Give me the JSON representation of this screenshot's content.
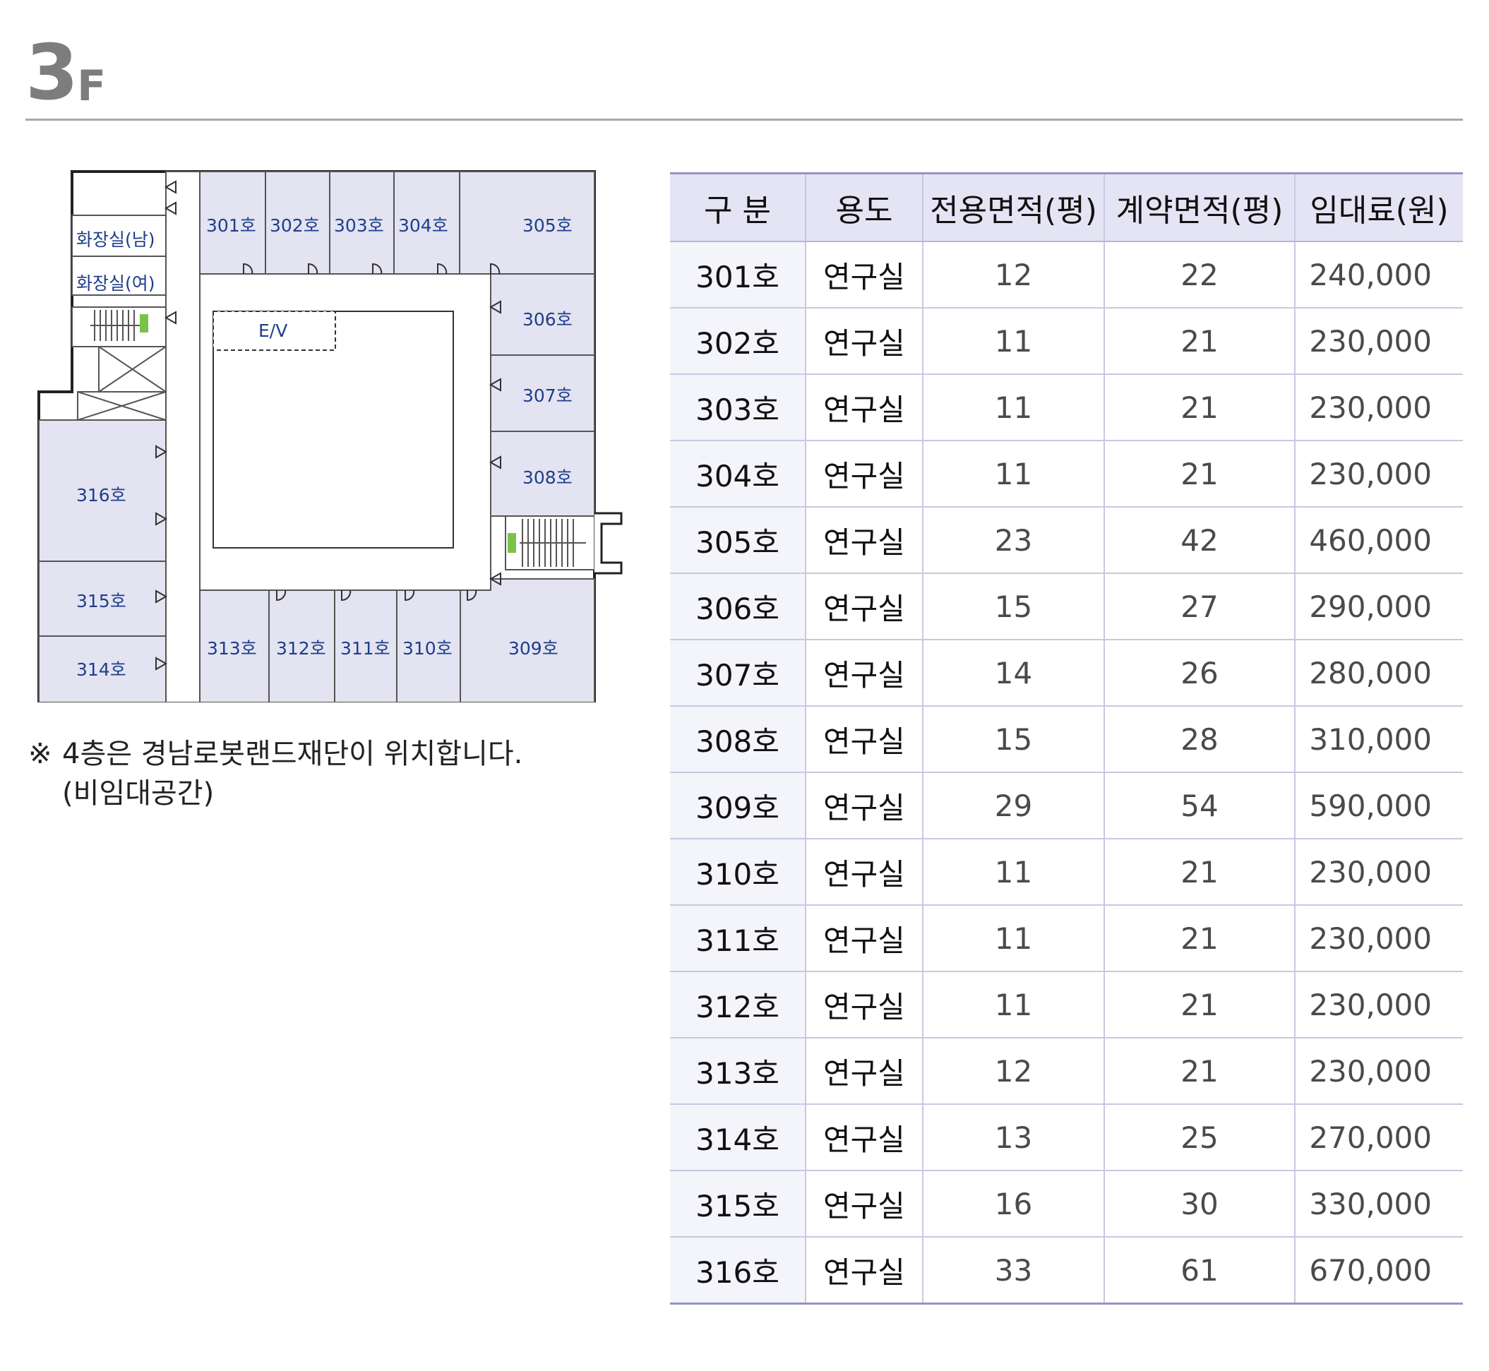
{
  "header": {
    "floor_number": "3",
    "floor_suffix": "F"
  },
  "floorplan": {
    "rooms": [
      "301호",
      "302호",
      "303호",
      "304호",
      "305호",
      "306호",
      "307호",
      "308호",
      "309호",
      "310호",
      "311호",
      "312호",
      "313호",
      "314호",
      "315호",
      "316호"
    ],
    "restroom_male": "화장실(남)",
    "restroom_female": "화장실(여)",
    "elevator": "E/V",
    "colors": {
      "room_fill": "#e3e3f1",
      "label": "#1f3e8a",
      "wall": "#222222",
      "exit_sign": "#7cc24a"
    }
  },
  "note": {
    "mark": "※",
    "line1": "4층은 경남로봇랜드재단이 위치합니다.",
    "line2": "(비임대공간)"
  },
  "table": {
    "headers": [
      "구 분",
      "용도",
      "전용면적(평)",
      "계약면적(평)",
      "임대료(원)"
    ],
    "rows": [
      [
        "301호",
        "연구실",
        "12",
        "22",
        "240,000"
      ],
      [
        "302호",
        "연구실",
        "11",
        "21",
        "230,000"
      ],
      [
        "303호",
        "연구실",
        "11",
        "21",
        "230,000"
      ],
      [
        "304호",
        "연구실",
        "11",
        "21",
        "230,000"
      ],
      [
        "305호",
        "연구실",
        "23",
        "42",
        "460,000"
      ],
      [
        "306호",
        "연구실",
        "15",
        "27",
        "290,000"
      ],
      [
        "307호",
        "연구실",
        "14",
        "26",
        "280,000"
      ],
      [
        "308호",
        "연구실",
        "15",
        "28",
        "310,000"
      ],
      [
        "309호",
        "연구실",
        "29",
        "54",
        "590,000"
      ],
      [
        "310호",
        "연구실",
        "11",
        "21",
        "230,000"
      ],
      [
        "311호",
        "연구실",
        "11",
        "21",
        "230,000"
      ],
      [
        "312호",
        "연구실",
        "11",
        "21",
        "230,000"
      ],
      [
        "313호",
        "연구실",
        "12",
        "21",
        "230,000"
      ],
      [
        "314호",
        "연구실",
        "13",
        "25",
        "270,000"
      ],
      [
        "315호",
        "연구실",
        "16",
        "30",
        "330,000"
      ],
      [
        "316호",
        "연구실",
        "33",
        "61",
        "670,000"
      ]
    ]
  }
}
